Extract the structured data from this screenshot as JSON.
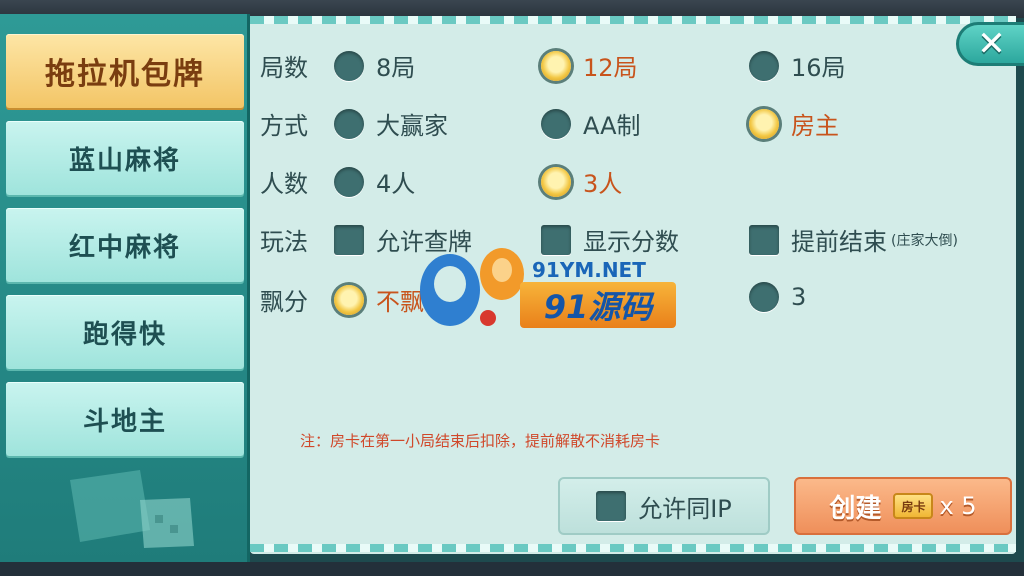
{
  "sidebar": {
    "items": [
      {
        "label": "拖拉机包牌",
        "active": true
      },
      {
        "label": "蓝山麻将",
        "active": false
      },
      {
        "label": "红中麻将",
        "active": false
      },
      {
        "label": "跑得快",
        "active": false
      },
      {
        "label": "斗地主",
        "active": false
      }
    ]
  },
  "close": {
    "label": "✕",
    "icon": "close-icon"
  },
  "rows": {
    "rounds": {
      "label": "局数",
      "options": [
        {
          "label": "8局",
          "selected": false
        },
        {
          "label": "12局",
          "selected": true
        },
        {
          "label": "16局",
          "selected": false
        }
      ]
    },
    "mode": {
      "label": "方式",
      "options": [
        {
          "label": "大赢家",
          "selected": false
        },
        {
          "label": "AA制",
          "selected": false
        },
        {
          "label": "房主",
          "selected": true
        }
      ]
    },
    "players": {
      "label": "人数",
      "options": [
        {
          "label": "4人",
          "selected": false
        },
        {
          "label": "3人",
          "selected": true
        }
      ]
    },
    "rules": {
      "label": "玩法",
      "options": [
        {
          "label": "允许查牌",
          "checked": false
        },
        {
          "label": "显示分数",
          "checked": false
        },
        {
          "label": "提前结束",
          "sub": "(庄家大倒)",
          "checked": false
        }
      ]
    },
    "float": {
      "label": "飘分",
      "options": [
        {
          "label": "不飘",
          "selected": true
        },
        {
          "label": "3",
          "selected": false
        }
      ]
    }
  },
  "note": "注：房卡在第一小局结束后扣除，提前解散不消耗房卡",
  "ip_button": {
    "label": "允许同IP",
    "checked": false
  },
  "create_button": {
    "label": "创建",
    "card_label": "房卡",
    "multiplier": "x 5"
  },
  "watermark": {
    "url": "91YM.NET",
    "name": "91源码"
  },
  "colors": {
    "selected_text": "#c8541c",
    "panel_bg": "#d3ece8",
    "sidebar_active": "#f3c566",
    "create_button": "#ef8f5a"
  }
}
